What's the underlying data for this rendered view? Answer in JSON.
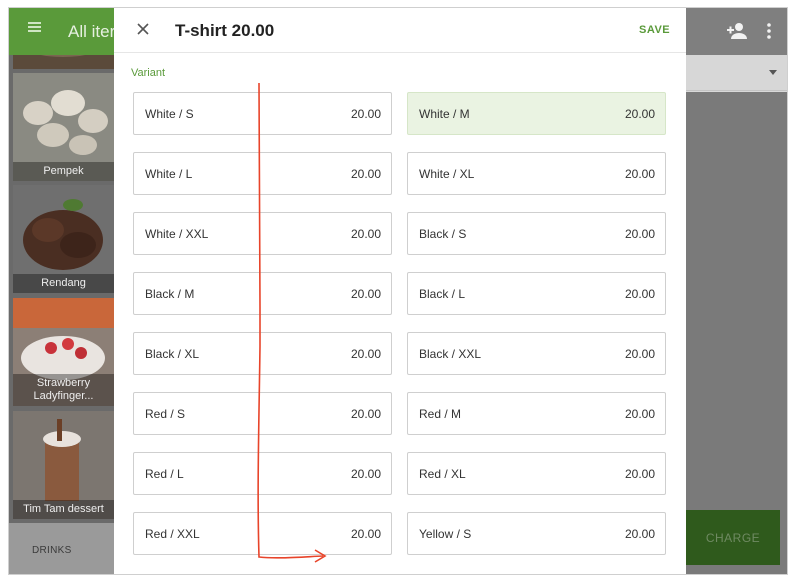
{
  "app": {
    "title": "All iter"
  },
  "grid_items": [
    {
      "name": ""
    },
    {
      "name": "Pempek"
    },
    {
      "name": "Rendang"
    },
    {
      "name": "Strawberry Ladyfinger..."
    },
    {
      "name": "Tim Tam dessert"
    }
  ],
  "category": "DRINKS",
  "charge_label": "CHARGE",
  "dialog": {
    "title": "T-shirt 20.00",
    "save_label": "SAVE",
    "section_label": "Variant",
    "variants": [
      {
        "name": "White / S",
        "price": "20.00",
        "selected": false
      },
      {
        "name": "White / M",
        "price": "20.00",
        "selected": true
      },
      {
        "name": "White / L",
        "price": "20.00",
        "selected": false
      },
      {
        "name": "White / XL",
        "price": "20.00",
        "selected": false
      },
      {
        "name": "White / XXL",
        "price": "20.00",
        "selected": false
      },
      {
        "name": "Black / S",
        "price": "20.00",
        "selected": false
      },
      {
        "name": "Black / M",
        "price": "20.00",
        "selected": false
      },
      {
        "name": "Black / L",
        "price": "20.00",
        "selected": false
      },
      {
        "name": "Black / XL",
        "price": "20.00",
        "selected": false
      },
      {
        "name": "Black / XXL",
        "price": "20.00",
        "selected": false
      },
      {
        "name": "Red / S",
        "price": "20.00",
        "selected": false
      },
      {
        "name": "Red / M",
        "price": "20.00",
        "selected": false
      },
      {
        "name": "Red / L",
        "price": "20.00",
        "selected": false
      },
      {
        "name": "Red / XL",
        "price": "20.00",
        "selected": false
      },
      {
        "name": "Red / XXL",
        "price": "20.00",
        "selected": false
      },
      {
        "name": "Yellow / S",
        "price": "20.00",
        "selected": false
      }
    ]
  },
  "colors": {
    "accent": "#5a9a3a",
    "selected_bg": "#eaf3e2",
    "annotation": "#e8442a"
  },
  "icons": {
    "menu": "menu-icon",
    "close": "close-icon",
    "add_person": "add-person-icon",
    "more": "more-vert-icon",
    "dropdown": "caret-down-icon"
  }
}
